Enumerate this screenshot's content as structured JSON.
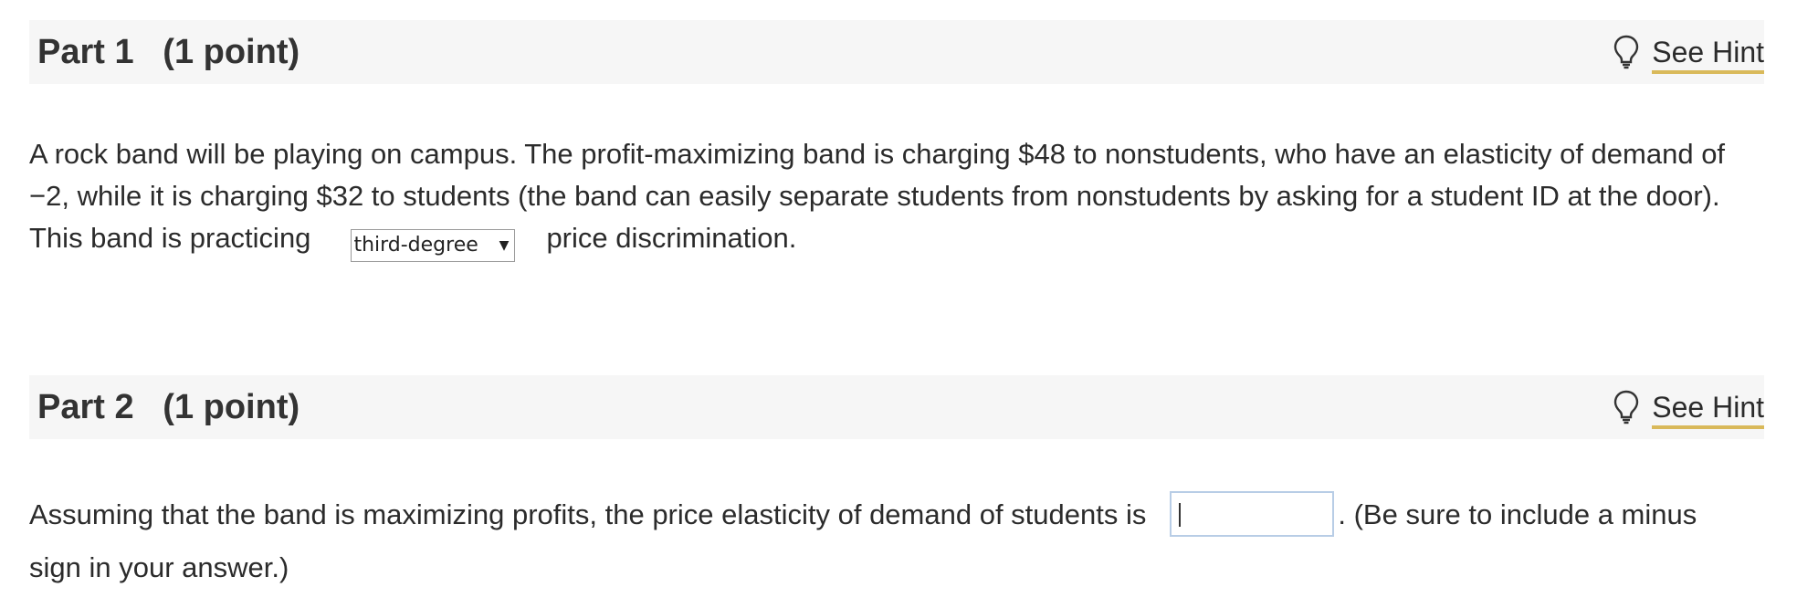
{
  "part1": {
    "title": "Part 1   (1 point)",
    "hint_label": "See Hint",
    "hint_icon": "lightbulb-icon",
    "text_line1": "A rock band will be playing on campus. The profit-maximizing band is charging $48 to nonstudents, who have an elasticity of demand of",
    "text_line2": "−2, while it is charging $32 to students (the band can easily separate students from nonstudents by asking for a student ID at the door).",
    "text_before_select": "This band is practicing",
    "select_value": "third-degree",
    "text_after_select": "price discrimination."
  },
  "part2": {
    "title": "Part 2   (1 point)",
    "hint_label": "See Hint",
    "hint_icon": "lightbulb-icon",
    "text_before_input": "Assuming that the band is maximizing profits, the price elasticity of demand of students is",
    "input_value": "",
    "text_after_input": ". (Be sure to include a minus",
    "text_line2": "sign in your answer.)"
  },
  "colors": {
    "header_bg": "#f6f6f6",
    "hint_underline": "#d9b95a",
    "input_border": "#b8cde6"
  }
}
